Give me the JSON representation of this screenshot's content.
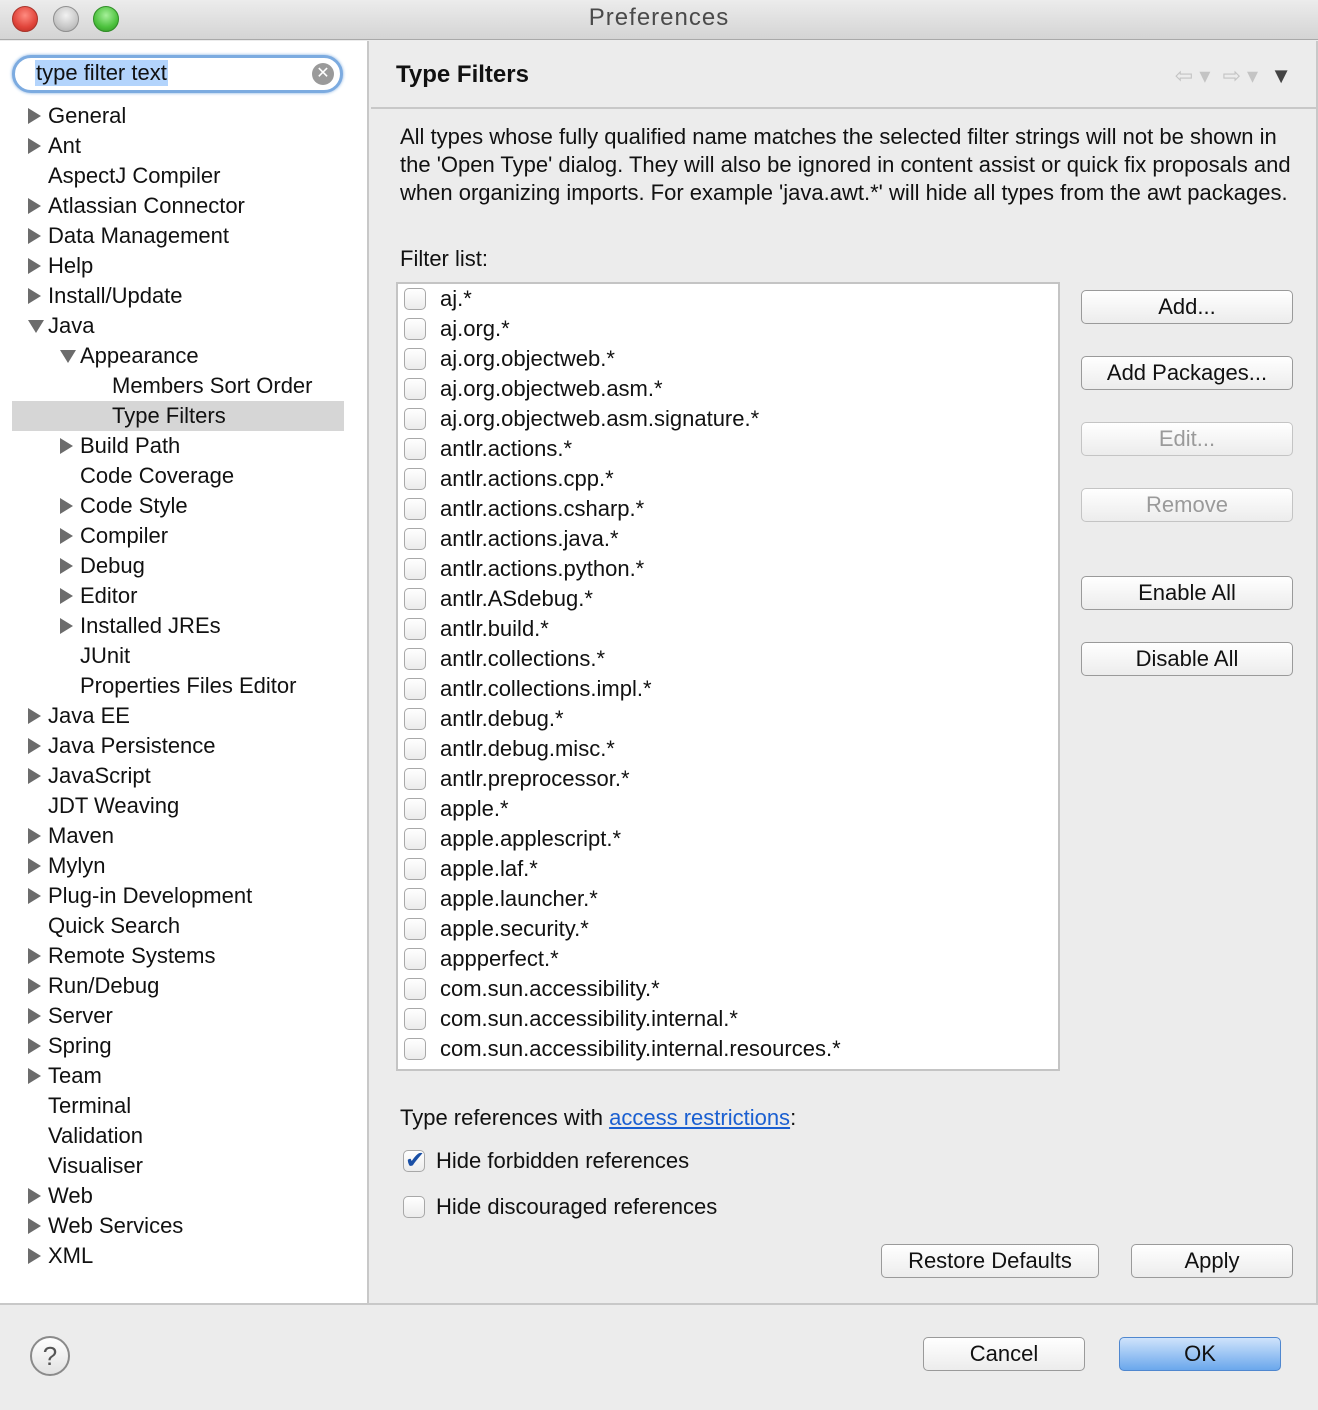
{
  "window": {
    "title": "Preferences"
  },
  "search": {
    "value": "type filter text"
  },
  "tree": [
    {
      "label": "General",
      "indent": 0,
      "arrow": "right"
    },
    {
      "label": "Ant",
      "indent": 0,
      "arrow": "right"
    },
    {
      "label": "AspectJ Compiler",
      "indent": 0,
      "arrow": "none"
    },
    {
      "label": "Atlassian Connector",
      "indent": 0,
      "arrow": "right"
    },
    {
      "label": "Data Management",
      "indent": 0,
      "arrow": "right"
    },
    {
      "label": "Help",
      "indent": 0,
      "arrow": "right"
    },
    {
      "label": "Install/Update",
      "indent": 0,
      "arrow": "right"
    },
    {
      "label": "Java",
      "indent": 0,
      "arrow": "down"
    },
    {
      "label": "Appearance",
      "indent": 1,
      "arrow": "down"
    },
    {
      "label": "Members Sort Order",
      "indent": 2,
      "arrow": "none"
    },
    {
      "label": "Type Filters",
      "indent": 2,
      "arrow": "none",
      "selected": true
    },
    {
      "label": "Build Path",
      "indent": 1,
      "arrow": "right"
    },
    {
      "label": "Code Coverage",
      "indent": 1,
      "arrow": "none"
    },
    {
      "label": "Code Style",
      "indent": 1,
      "arrow": "right"
    },
    {
      "label": "Compiler",
      "indent": 1,
      "arrow": "right"
    },
    {
      "label": "Debug",
      "indent": 1,
      "arrow": "right"
    },
    {
      "label": "Editor",
      "indent": 1,
      "arrow": "right"
    },
    {
      "label": "Installed JREs",
      "indent": 1,
      "arrow": "right"
    },
    {
      "label": "JUnit",
      "indent": 1,
      "arrow": "none"
    },
    {
      "label": "Properties Files Editor",
      "indent": 1,
      "arrow": "none"
    },
    {
      "label": "Java EE",
      "indent": 0,
      "arrow": "right"
    },
    {
      "label": "Java Persistence",
      "indent": 0,
      "arrow": "right"
    },
    {
      "label": "JavaScript",
      "indent": 0,
      "arrow": "right"
    },
    {
      "label": "JDT Weaving",
      "indent": 0,
      "arrow": "none"
    },
    {
      "label": "Maven",
      "indent": 0,
      "arrow": "right"
    },
    {
      "label": "Mylyn",
      "indent": 0,
      "arrow": "right"
    },
    {
      "label": "Plug-in Development",
      "indent": 0,
      "arrow": "right"
    },
    {
      "label": "Quick Search",
      "indent": 0,
      "arrow": "none"
    },
    {
      "label": "Remote Systems",
      "indent": 0,
      "arrow": "right"
    },
    {
      "label": "Run/Debug",
      "indent": 0,
      "arrow": "right"
    },
    {
      "label": "Server",
      "indent": 0,
      "arrow": "right"
    },
    {
      "label": "Spring",
      "indent": 0,
      "arrow": "right"
    },
    {
      "label": "Team",
      "indent": 0,
      "arrow": "right"
    },
    {
      "label": "Terminal",
      "indent": 0,
      "arrow": "none"
    },
    {
      "label": "Validation",
      "indent": 0,
      "arrow": "none"
    },
    {
      "label": "Visualiser",
      "indent": 0,
      "arrow": "none"
    },
    {
      "label": "Web",
      "indent": 0,
      "arrow": "right"
    },
    {
      "label": "Web Services",
      "indent": 0,
      "arrow": "right"
    },
    {
      "label": "XML",
      "indent": 0,
      "arrow": "right"
    }
  ],
  "page": {
    "title": "Type Filters",
    "description": "All types whose fully qualified name matches the selected filter strings will not be shown in the 'Open Type' dialog. They will also be ignored in content assist or quick fix proposals and when organizing imports. For example 'java.awt.*' will hide all types from the awt packages.",
    "filter_label": "Filter list:",
    "filters": [
      "aj.*",
      "aj.org.*",
      "aj.org.objectweb.*",
      "aj.org.objectweb.asm.*",
      "aj.org.objectweb.asm.signature.*",
      "antlr.actions.*",
      "antlr.actions.cpp.*",
      "antlr.actions.csharp.*",
      "antlr.actions.java.*",
      "antlr.actions.python.*",
      "antlr.ASdebug.*",
      "antlr.build.*",
      "antlr.collections.*",
      "antlr.collections.impl.*",
      "antlr.debug.*",
      "antlr.debug.misc.*",
      "antlr.preprocessor.*",
      "apple.*",
      "apple.applescript.*",
      "apple.laf.*",
      "apple.launcher.*",
      "apple.security.*",
      "appperfect.*",
      "com.sun.accessibility.*",
      "com.sun.accessibility.internal.*",
      "com.sun.accessibility.internal.resources.*"
    ],
    "buttons": {
      "add": "Add...",
      "add_packages": "Add Packages...",
      "edit": "Edit...",
      "remove": "Remove",
      "enable_all": "Enable All",
      "disable_all": "Disable All"
    },
    "access_prefix": "Type references with ",
    "access_link": "access restrictions",
    "access_suffix": ":",
    "hide_forbidden": {
      "label": "Hide forbidden references",
      "checked": true
    },
    "hide_discouraged": {
      "label": "Hide discouraged references",
      "checked": false
    },
    "restore_defaults": "Restore Defaults",
    "apply": "Apply"
  },
  "footer": {
    "help_symbol": "?",
    "cancel": "Cancel",
    "ok": "OK"
  },
  "icons": {
    "back": "back-arrow-icon",
    "forward": "forward-arrow-icon",
    "menu": "view-menu-icon"
  },
  "colors": {
    "link": "#1a5fd1",
    "selection": "#d6d6d6",
    "primary_button": "#6aa7ec"
  }
}
